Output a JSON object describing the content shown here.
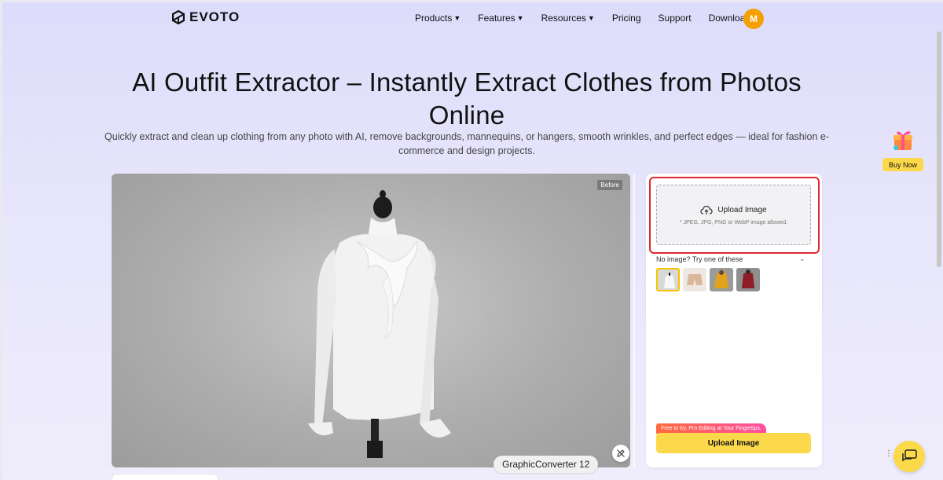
{
  "header": {
    "logo_text": "EVOTO",
    "nav": [
      {
        "label": "Products",
        "dropdown": true
      },
      {
        "label": "Features",
        "dropdown": true
      },
      {
        "label": "Resources",
        "dropdown": true
      },
      {
        "label": "Pricing",
        "dropdown": false
      },
      {
        "label": "Support",
        "dropdown": false
      },
      {
        "label": "Download",
        "dropdown": false
      }
    ],
    "avatar_initial": "M",
    "avatar_color": "#f5a000"
  },
  "hero": {
    "title": "AI Outfit Extractor – Instantly Extract Clothes from Photos Online",
    "subtitle": "Quickly extract and clean up clothing from any photo with AI, remove backgrounds, mannequins, or hangers, smooth wrinkles, and perfect edges — ideal for fashion e-commerce and design projects."
  },
  "preview": {
    "badge": "Before"
  },
  "upload_panel": {
    "upload_label": "Upload Image",
    "upload_note": "* JPEG, JPG, PNG or WebP image allowed.",
    "try_label": "No image? Try one of these",
    "samples": [
      "white-blouse",
      "beige-shorts",
      "yellow-jacket",
      "red-blazer"
    ],
    "promo_tag": "Free to try. Pro Editing at Your Fingertips.",
    "upload_button": "Upload Image",
    "accent_color": "#fcd94a",
    "highlight_color": "#e0282e"
  },
  "floating": {
    "buy_now": "Buy Now",
    "tooltip": "GraphicConverter 12"
  }
}
